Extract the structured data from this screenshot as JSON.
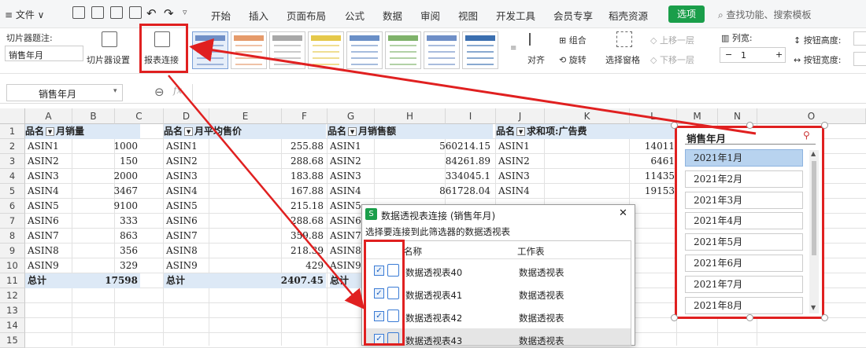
{
  "menubar": {
    "file": "≡ 文件 ∨",
    "tabs": [
      "开始",
      "插入",
      "页面布局",
      "公式",
      "数据",
      "审阅",
      "视图",
      "开发工具",
      "会员专享",
      "稻壳资源"
    ],
    "go": "选项",
    "search": "查找功能、搜索模板"
  },
  "ribbon": {
    "slicer_caption_label": "切片器题注:",
    "slicer_caption_value": "销售年月",
    "slicer_settings": "切片器设置",
    "report_connect": "报表连接",
    "align": "对齐",
    "group": "组合",
    "rotate": "旋转",
    "select_pane": "选择窗格",
    "bring_forward": "上移一层",
    "send_backward": "下移一层",
    "columns_label": "列宽:",
    "columns_value": "1",
    "btn_height": "按钮高度:",
    "btn_width": "按钮宽度:"
  },
  "namebox": "销售年月",
  "columns": [
    "A",
    "B",
    "C",
    "D",
    "E",
    "F",
    "G",
    "H",
    "I",
    "J",
    "K",
    "L",
    "M",
    "N",
    "O"
  ],
  "rows": [
    "1",
    "2",
    "3",
    "4",
    "5",
    "6",
    "7",
    "8",
    "9",
    "10",
    "11",
    "12",
    "13",
    "14",
    "15"
  ],
  "table1": {
    "h1": "品名",
    "h2": "月销量",
    "names": [
      "ASIN1",
      "ASIN2",
      "ASIN3",
      "ASIN4",
      "ASIN5",
      "ASIN6",
      "ASIN7",
      "ASIN8",
      "ASIN9"
    ],
    "vals": [
      "1000",
      "150",
      "2000",
      "3467",
      "9100",
      "333",
      "863",
      "356",
      "329"
    ],
    "total_label": "总计",
    "total": "17598"
  },
  "table2": {
    "h1": "品名",
    "h2": "月平均售价",
    "names": [
      "ASIN1",
      "ASIN2",
      "ASIN3",
      "ASIN4",
      "ASIN5",
      "ASIN6",
      "ASIN7",
      "ASIN8",
      "ASIN9"
    ],
    "vals": [
      "255.88",
      "288.68",
      "183.88",
      "167.88",
      "215.18",
      "288.68",
      "359.88",
      "218.39",
      "429"
    ],
    "total_label": "总计",
    "total": "2407.45"
  },
  "table3": {
    "h1": "品名",
    "h2": "月销售额",
    "names": [
      "ASIN1",
      "ASIN2",
      "ASIN3",
      "ASIN4",
      "ASIN5",
      "ASIN6",
      "ASIN7",
      "ASIN8",
      "ASIN9"
    ],
    "vals": [
      "560214.15",
      "84261.89",
      "334045.1",
      "861728.04"
    ],
    "total_label": "总计"
  },
  "table4": {
    "h1": "品名",
    "h2": "求和项:广告费",
    "names": [
      "ASIN1",
      "ASIN2",
      "ASIN3",
      "ASIN4"
    ],
    "vals": [
      "14011",
      "6461",
      "11435",
      "19153"
    ]
  },
  "slicer": {
    "title": "销售年月",
    "items": [
      "2021年1月",
      "2021年2月",
      "2021年3月",
      "2021年4月",
      "2021年5月",
      "2021年6月",
      "2021年7月",
      "2021年8月"
    ]
  },
  "dialog": {
    "title": "数据透视表连接 (销售年月)",
    "subtitle": "选择要连接到此筛选器的数据透视表",
    "col_name": "名称",
    "col_sheet": "工作表",
    "rows": [
      {
        "name": "数据透视表40",
        "sheet": "数据透视表"
      },
      {
        "name": "数据透视表41",
        "sheet": "数据透视表"
      },
      {
        "name": "数据透视表42",
        "sheet": "数据透视表"
      },
      {
        "name": "数据透视表43",
        "sheet": "数据透视表"
      }
    ],
    "check": "✓",
    "close": "✕"
  },
  "colors": {
    "accent": "#1a9e4a",
    "annotation": "#e02020",
    "header_fill": "#dde9f6",
    "selected": "#b8d3ef"
  }
}
